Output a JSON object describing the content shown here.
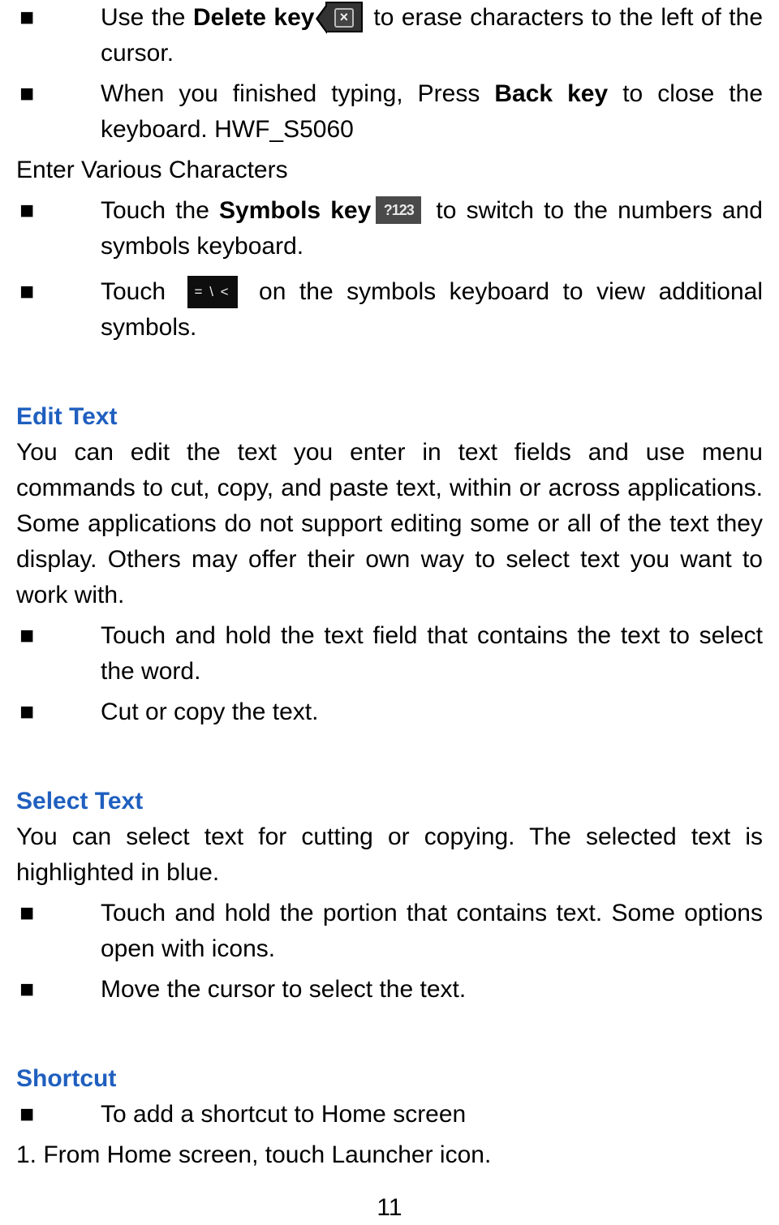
{
  "top_bullets": {
    "b1": {
      "pre": "Use the ",
      "bold": "Delete key ",
      "post": " to erase characters to the left of the cursor."
    },
    "b2": {
      "pre": "When you finished typing, Press ",
      "bold": "Back key",
      "post": " to close the keyboard. HWF_S5060"
    }
  },
  "enter_chars_label": "Enter Various Characters",
  "enter_chars": {
    "b1": {
      "pre": "Touch the ",
      "bold": "Symbols key",
      "sym_label": "?123",
      "post": " to switch to the numbers and symbols keyboard."
    },
    "b2": {
      "pre": "Touch ",
      "ext_label": "= \\ <",
      "post": " on the symbols keyboard to view additional symbols."
    }
  },
  "edit_text": {
    "heading": "Edit Text",
    "para": "You can edit the text you enter in text fields and use menu commands to cut, copy, and paste text, within or across applications. Some applications do not support editing some or all of the text they display. Others may offer their own way to select text you want to work with.",
    "b1": "Touch and hold the text field that contains the text to select the word.",
    "b2": "Cut or copy the text."
  },
  "select_text": {
    "heading": "Select Text",
    "para": "You can select text for cutting or copying. The selected text is highlighted in blue.",
    "b1": "Touch and hold the portion that contains text. Some options open with icons.",
    "b2": "Move the cursor to select the text."
  },
  "shortcut": {
    "heading": "Shortcut",
    "b1": "To add a shortcut to Home screen",
    "n1": "1. From Home screen, touch Launcher icon."
  },
  "page_number": "11"
}
